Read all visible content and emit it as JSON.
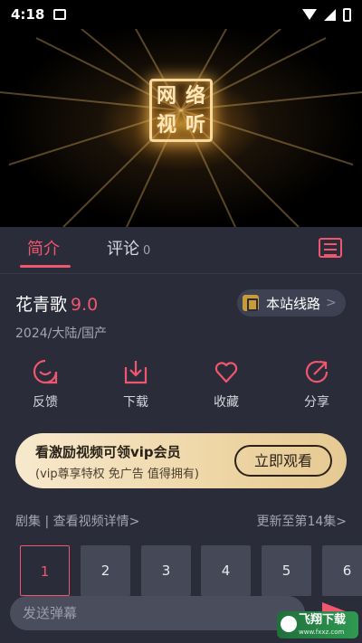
{
  "status_bar": {
    "time": "4:18"
  },
  "video": {
    "logo_chars": [
      "网",
      "络",
      "视",
      "听"
    ]
  },
  "tabs": [
    {
      "label": "简介",
      "active": true
    },
    {
      "label": "评论",
      "count": "0",
      "active": false
    }
  ],
  "detail": {
    "title": "花青歌",
    "rating": "9.0",
    "meta": "2024/大陆/国产",
    "route_label": "本站线路",
    "route_chevron": ">"
  },
  "actions": [
    {
      "label": "反馈",
      "icon": "feedback-smile-icon"
    },
    {
      "label": "下载",
      "icon": "download-icon"
    },
    {
      "label": "收藏",
      "icon": "heart-icon"
    },
    {
      "label": "分享",
      "icon": "share-icon"
    }
  ],
  "vip": {
    "title": "看激励视频可领vip会员",
    "subtitle": "(vip尊享特权 免广告 值得拥有)",
    "button": "立即观看"
  },
  "episodes": {
    "left_label": "剧集 | 查看视频详情>",
    "right_label": "更新至第14集>",
    "items": [
      "1",
      "2",
      "3",
      "4",
      "5",
      "6"
    ],
    "selected": "1"
  },
  "danmaku": {
    "placeholder": "发送弹幕"
  },
  "watermark": {
    "title": "飞翔下载",
    "sub": "www.fxxz.com"
  },
  "colors": {
    "accent": "#f0566e",
    "background": "#2a2c3a",
    "vip_gold": "#eed6a6"
  }
}
